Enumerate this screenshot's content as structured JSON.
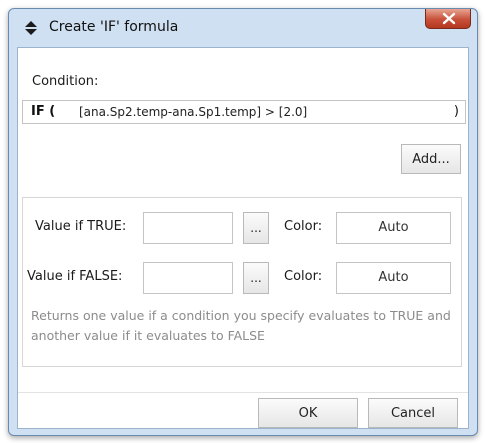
{
  "window": {
    "title": "Create 'IF' formula",
    "title_icon": "sort-arrows-icon",
    "close_icon": "close-x-icon"
  },
  "condition": {
    "label": "Condition:",
    "prefix": "IF (",
    "expression": "[ana.Sp2.temp-ana.Sp1.temp] > [2.0]",
    "suffix": ")",
    "add_button": "Add..."
  },
  "values": {
    "true_label": "Value if TRUE:",
    "true_value": "",
    "true_browse": "...",
    "true_color_label": "Color:",
    "true_color_value": "Auto",
    "false_label": "Value if FALSE:",
    "false_value": "",
    "false_browse": "...",
    "false_color_label": "Color:",
    "false_color_value": "Auto",
    "help_text": "Returns one value if a condition you specify evaluates to TRUE and another value if it evaluates to FALSE"
  },
  "footer": {
    "ok_label": "OK",
    "cancel_label": "Cancel"
  }
}
